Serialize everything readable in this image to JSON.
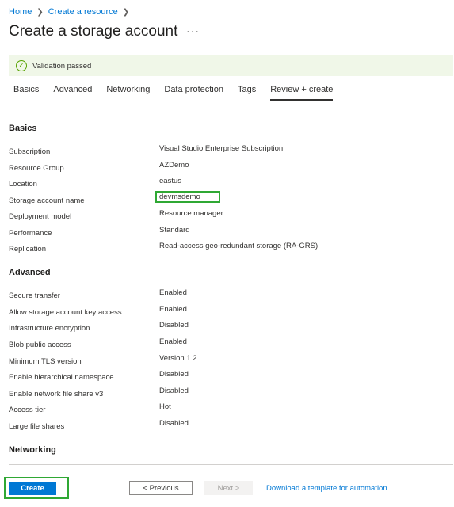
{
  "breadcrumb": {
    "home": "Home",
    "create_resource": "Create a resource"
  },
  "page": {
    "title": "Create a storage account",
    "more": "···"
  },
  "validation": {
    "message": "Validation passed"
  },
  "tabs": [
    "Basics",
    "Advanced",
    "Networking",
    "Data protection",
    "Tags",
    "Review + create"
  ],
  "sections": {
    "basics": {
      "title": "Basics",
      "rows": [
        {
          "label": "Subscription",
          "value": "Visual Studio Enterprise Subscription"
        },
        {
          "label": "Resource Group",
          "value": "AZDemo"
        },
        {
          "label": "Location",
          "value": "eastus"
        },
        {
          "label": "Storage account name",
          "value": "devmsdemo"
        },
        {
          "label": "Deployment model",
          "value": "Resource manager"
        },
        {
          "label": "Performance",
          "value": "Standard"
        },
        {
          "label": "Replication",
          "value": "Read-access geo-redundant storage (RA-GRS)"
        }
      ]
    },
    "advanced": {
      "title": "Advanced",
      "rows": [
        {
          "label": "Secure transfer",
          "value": "Enabled"
        },
        {
          "label": "Allow storage account key access",
          "value": "Enabled"
        },
        {
          "label": "Infrastructure encryption",
          "value": "Disabled"
        },
        {
          "label": "Blob public access",
          "value": "Enabled"
        },
        {
          "label": "Minimum TLS version",
          "value": "Version 1.2"
        },
        {
          "label": "Enable hierarchical namespace",
          "value": "Disabled"
        },
        {
          "label": "Enable network file share v3",
          "value": "Disabled"
        },
        {
          "label": "Access tier",
          "value": "Hot"
        },
        {
          "label": "Large file shares",
          "value": "Disabled"
        }
      ]
    },
    "networking": {
      "title": "Networking"
    }
  },
  "footer": {
    "create": "Create",
    "previous": "< Previous",
    "next": "Next >",
    "download": "Download a template for automation"
  }
}
